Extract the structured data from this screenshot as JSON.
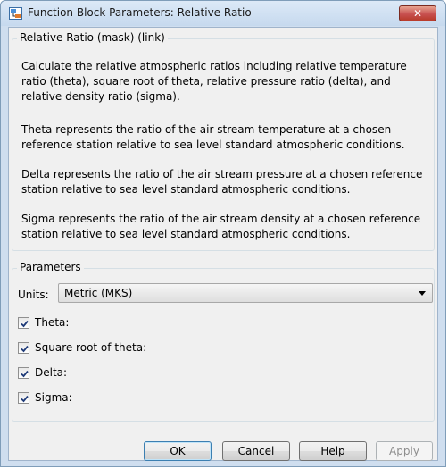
{
  "window": {
    "title": "Function Block Parameters: Relative Ratio",
    "close_symbol": "✕"
  },
  "description": {
    "heading": "Relative Ratio (mask) (link)",
    "paragraphs": [
      [
        "Calculate the relative atmospheric ratios including relative temperature",
        "ratio (theta), square root of theta, relative pressure ratio (delta), and",
        "relative density ratio (sigma)."
      ],
      [
        "Theta represents the ratio of the air stream temperature at a chosen",
        "reference station relative to sea level standard atmospheric conditions."
      ],
      [
        "Delta represents the ratio of the air stream pressure at a chosen reference",
        "station relative to sea level standard atmospheric conditions."
      ],
      [
        "Sigma represents the ratio of the air stream density at a chosen reference",
        "station relative to sea level standard atmospheric conditions."
      ]
    ]
  },
  "parameters": {
    "heading": "Parameters",
    "units_label": "Units:",
    "units_value": "Metric (MKS)",
    "checkboxes": [
      {
        "label": "Theta:",
        "checked": true
      },
      {
        "label": "Square root of theta:",
        "checked": true
      },
      {
        "label": "Delta:",
        "checked": true
      },
      {
        "label": "Sigma:",
        "checked": true
      }
    ]
  },
  "buttons": {
    "ok": "OK",
    "cancel": "Cancel",
    "help": "Help",
    "apply": "Apply"
  }
}
